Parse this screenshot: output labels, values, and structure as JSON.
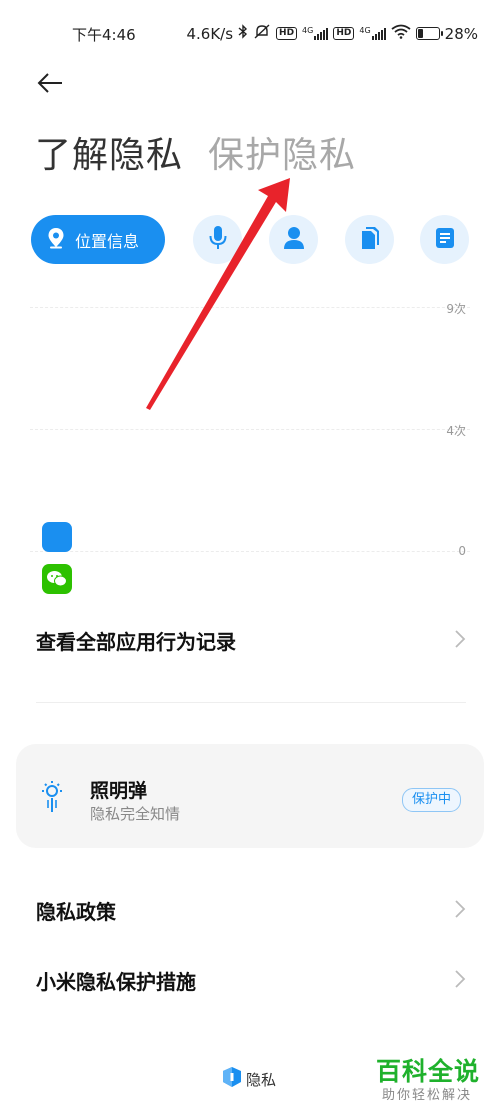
{
  "status_bar": {
    "time": "下午4:46",
    "network_speed": "4.6K/s",
    "sim1_badge": "HD",
    "sim1_network": "4G",
    "sim2_badge": "HD",
    "sim2_network": "4G",
    "battery": "28%",
    "battery_level": 0.28,
    "icons": [
      "bluetooth-icon",
      "mute-icon",
      "signal-icon",
      "wifi-icon",
      "battery-icon"
    ]
  },
  "header": {
    "back_icon": "back-arrow-icon",
    "tabs": [
      {
        "label": "了解隐私",
        "active": true
      },
      {
        "label": "保护隐私",
        "active": false
      }
    ]
  },
  "categories": [
    {
      "label": "位置信息",
      "icon": "location-pin-icon",
      "selected": true
    },
    {
      "label": "",
      "icon": "microphone-icon",
      "selected": false
    },
    {
      "label": "",
      "icon": "contact-person-icon",
      "selected": false
    },
    {
      "label": "",
      "icon": "files-icon",
      "selected": false
    },
    {
      "label": "",
      "icon": "document-icon",
      "selected": false
    }
  ],
  "chart": {
    "y_ticks": [
      "9次",
      "4次",
      "0"
    ],
    "apps": [
      {
        "icon": "blue-app-icon",
        "color": "#1a8ff0"
      },
      {
        "icon": "wechat-icon",
        "color": "#2dc100"
      }
    ]
  },
  "rows": {
    "view_all": "查看全部应用行为记录",
    "privacy_policy": "隐私政策",
    "xiaomi_measures": "小米隐私保护措施"
  },
  "flare_card": {
    "title": "照明弹",
    "subtitle": "隐私完全知情",
    "badge": "保护中",
    "icon": "flare-lightbulb-icon"
  },
  "footer": {
    "brand": "隐私",
    "brand_icon": "privacy-shield-icon"
  },
  "watermark": {
    "title": "百科全说",
    "subtitle": "助你轻松解决"
  },
  "colors": {
    "accent": "#1a8ff0",
    "chip_bg": "#e6f2fd",
    "annotation_arrow": "#e8232b",
    "watermark_green": "#1fb12c"
  }
}
